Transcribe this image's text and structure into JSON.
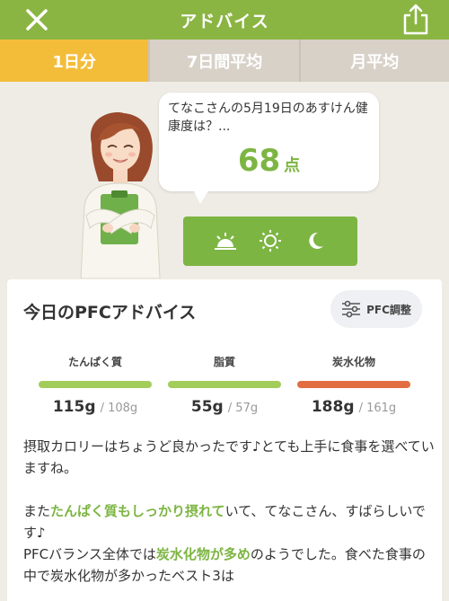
{
  "header": {
    "title": "アドバイス",
    "close_icon": "close-icon",
    "share_icon": "share-icon",
    "color": "#8bb543"
  },
  "tabs": [
    {
      "label": "1日分",
      "active": true
    },
    {
      "label": "7日間平均",
      "active": false
    },
    {
      "label": "月平均",
      "active": false
    }
  ],
  "bubble": {
    "message": "てなこさんの5月19日のあすけん健康度は？...",
    "score": "68",
    "score_unit": "点"
  },
  "time_icons": [
    "sunrise-icon",
    "sun-icon",
    "moon-icon"
  ],
  "pfc_card": {
    "title": "今日のPFCアドバイス",
    "adjust_button": "PFC調整",
    "nutrients": [
      {
        "name": "たんぱく質",
        "actual": "115g",
        "target": "/ 108g",
        "bar_color": "#a2cd5a"
      },
      {
        "name": "脂質",
        "actual": "55g",
        "target": "/ 57g",
        "bar_color": "#a2cd5a"
      },
      {
        "name": "炭水化物",
        "actual": "188g",
        "target": "/ 161g",
        "bar_color": "#e26d43"
      }
    ],
    "advice": {
      "p1": "摂取カロリーはちょうど良かったです♪とても上手に食事を選べていますね。",
      "p2_a": "また",
      "p2_hl": "たんぱく質もしっかり摂れて",
      "p2_b": "いて、てなこさん、すばらしいです♪",
      "p3_a": "PFCバランス全体では",
      "p3_hl": "炭水化物が多め",
      "p3_b": "のようでした。食べた食事の中で炭水化物が多かったベスト3は"
    }
  }
}
